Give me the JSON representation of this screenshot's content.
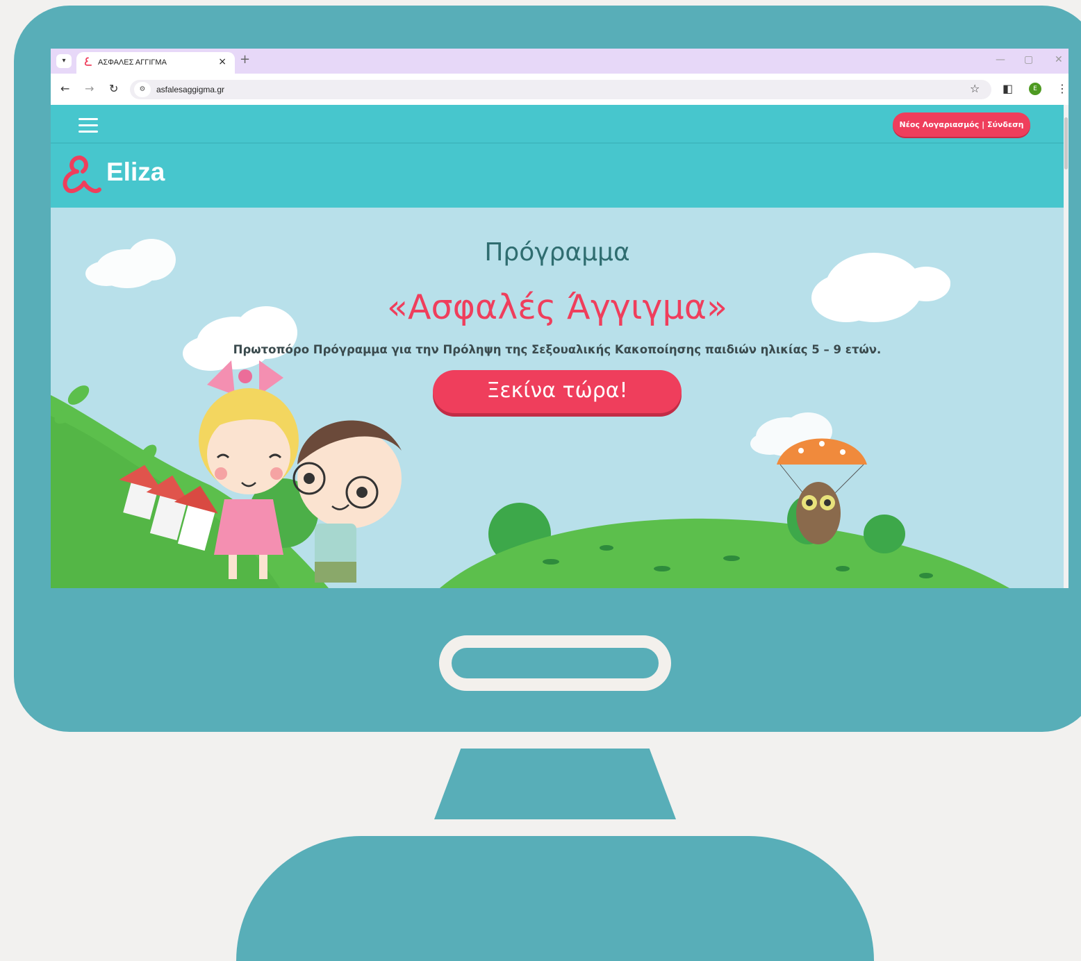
{
  "browser": {
    "tab_title": "ΑΣΦΑΛΕΣ ΑΓΓΙΓΜΑ",
    "tab_close": "×",
    "new_tab": "+",
    "url": "asfalesaggigma.gr",
    "profile_initial": "E"
  },
  "site": {
    "logo_text": "Eliza",
    "account_button": "Νέος Λογαριασμός | Σύνδεση"
  },
  "hero": {
    "subtitle": "Πρόγραμμα",
    "title": "«Ασφαλές Άγγιγμα»",
    "description": "Πρωτοπόρο Πρόγραμμα για την Πρόληψη της Σεξουαλικής Κακοποίησης παιδιών ηλικίας 5 – 9 ετών.",
    "cta": "Ξεκίνα τώρα!"
  },
  "icons": {
    "tab_dropdown": "chevron-down-icon",
    "back": "arrow-left-icon",
    "forward": "arrow-right-icon",
    "reload": "reload-icon",
    "site_info": "tune-icon",
    "bookmark": "star-icon",
    "side_panel": "side-panel-icon",
    "menu": "kebab-menu-icon",
    "hamburger": "hamburger-icon"
  },
  "colors": {
    "monitor": "#58aeb8",
    "header": "#47c6cd",
    "accent": "#ef3e5c",
    "tabbar": "#e7d8f8",
    "sky": "#b8e0ea",
    "grass": "#5cbf4c"
  }
}
